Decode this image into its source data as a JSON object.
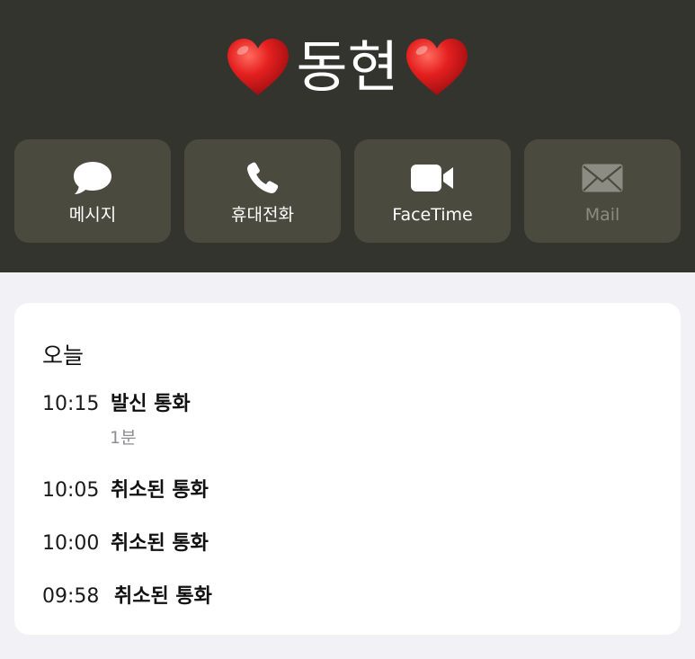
{
  "contact": {
    "name": "동현",
    "heart_icon": "red-heart-icon",
    "heart_color": "#e4201f"
  },
  "actions": [
    {
      "label": "메시지",
      "icon": "message-bubble-icon",
      "enabled": true
    },
    {
      "label": "휴대전화",
      "icon": "phone-icon",
      "enabled": true
    },
    {
      "label": "FaceTime",
      "icon": "video-camera-icon",
      "enabled": true
    },
    {
      "label": "Mail",
      "icon": "envelope-icon",
      "enabled": false
    }
  ],
  "history": {
    "section_title": "오늘",
    "calls": [
      {
        "time": "10:15",
        "type": "발신 통화",
        "duration": "1분"
      },
      {
        "time": "10:05",
        "type": "취소된 통화",
        "duration": ""
      },
      {
        "time": "10:00",
        "type": "취소된 통화",
        "duration": ""
      },
      {
        "time": "09:58",
        "type": "취소된 통화",
        "duration": ""
      }
    ]
  },
  "colors": {
    "header_bg": "#34342e",
    "button_bg": "#4a4a3f",
    "page_bg": "#f2f1f6",
    "card_bg": "#ffffff",
    "disabled_text": "#8d8c82",
    "secondary_text": "#8e8e93"
  }
}
